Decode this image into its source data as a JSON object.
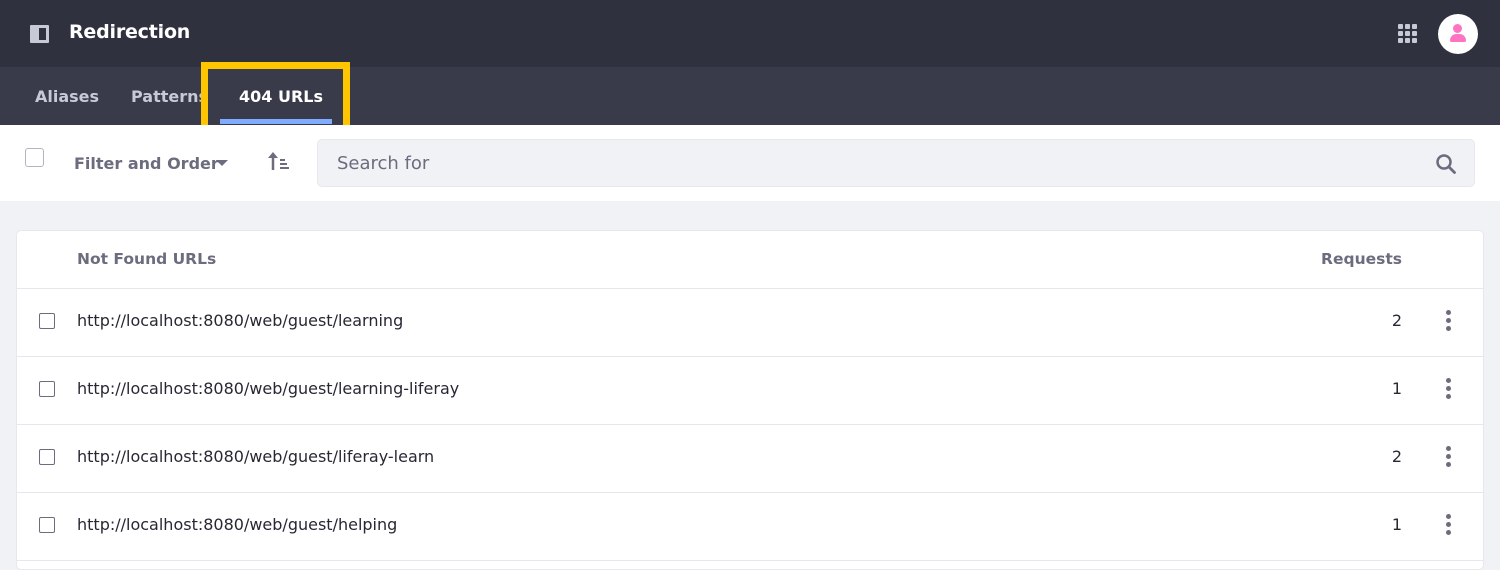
{
  "header": {
    "title": "Redirection",
    "panel_icon": "product-menu-icon",
    "apps_icon": "apps-grid-icon",
    "avatar_icon": "user-avatar-icon"
  },
  "nav": {
    "tabs": [
      {
        "label": "Aliases",
        "active": false
      },
      {
        "label": "Patterns",
        "active": false
      },
      {
        "label": "404 URLs",
        "active": true
      }
    ],
    "accent_color": "#80acff",
    "highlight_color": "#ffc500"
  },
  "toolbar": {
    "filter_label": "Filter and Order",
    "search_placeholder": "Search for"
  },
  "table": {
    "columns": [
      "Not Found URLs",
      "Requests"
    ],
    "rows": [
      {
        "url": "http://localhost:8080/web/guest/learning",
        "requests": "2"
      },
      {
        "url": "http://localhost:8080/web/guest/learning-liferay",
        "requests": "1"
      },
      {
        "url": "http://localhost:8080/web/guest/liferay-learn",
        "requests": "2"
      },
      {
        "url": "http://localhost:8080/web/guest/helping",
        "requests": "1"
      }
    ]
  }
}
